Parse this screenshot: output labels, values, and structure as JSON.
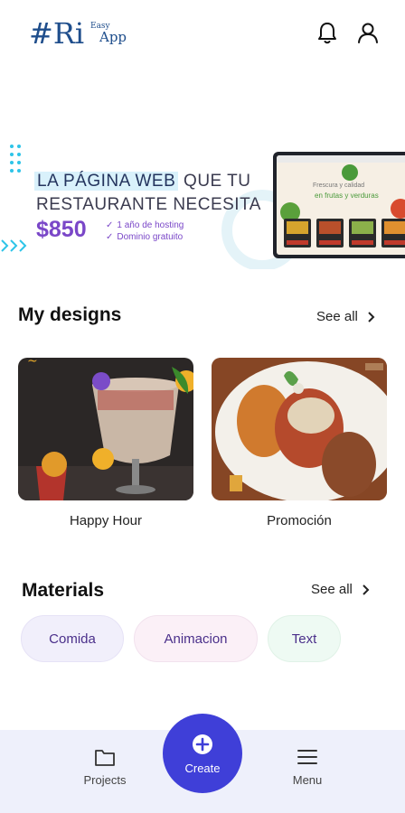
{
  "header": {
    "logo_mark": "#Ri",
    "logo_easy": "Easy",
    "logo_app": "App"
  },
  "banner": {
    "line1_highlight": "LA PÁGINA WEB",
    "line1_rest": " QUE TU",
    "line2": "RESTAURANTE NECESITA",
    "price": "$850",
    "feature1": "1 año de hosting",
    "feature2": "Dominio gratuito",
    "screen_text1": "Frescura y calidad",
    "screen_text2": "en frutas y verduras",
    "colors": {
      "highlight": "#d9f1fb",
      "price": "#7a47c8",
      "dots": "#2ec4e8"
    }
  },
  "designs": {
    "title": "My designs",
    "see_all": "See all",
    "items": [
      {
        "label": "Happy Hour",
        "icon": "cocktail-image"
      },
      {
        "label": "Promoción",
        "icon": "food-plate-image"
      }
    ]
  },
  "materials": {
    "title": "Materials",
    "see_all": "See all",
    "chips": [
      {
        "label": "Comida",
        "color": "#f1effb"
      },
      {
        "label": "Animacion",
        "color": "#fbf0f7"
      },
      {
        "label": "Text",
        "color": "#eefaf3"
      }
    ]
  },
  "nav": {
    "projects": "Projects",
    "create": "Create",
    "menu": "Menu",
    "accent": "#3f3fd8"
  }
}
